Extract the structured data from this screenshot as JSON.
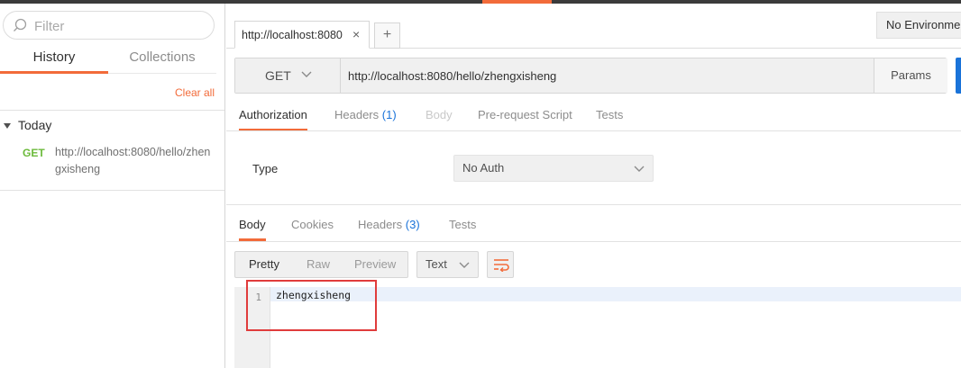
{
  "sidebar": {
    "filter_placeholder": "Filter",
    "tabs": [
      {
        "label": "History",
        "active": true
      },
      {
        "label": "Collections",
        "active": false
      }
    ],
    "clear_all": "Clear all",
    "group_label": "Today",
    "history": [
      {
        "method": "GET",
        "url": "http://localhost:8080/hello/zhengxisheng"
      }
    ]
  },
  "main": {
    "request_tab_label": "http://localhost:8080",
    "add_tab": "+",
    "close_tab": "×",
    "environment": "No Environment",
    "method": "GET",
    "url": "http://localhost:8080/hello/zhengxisheng",
    "params_label": "Params",
    "request_tabs": {
      "authorization": "Authorization",
      "headers": "Headers",
      "headers_count": "(1)",
      "body": "Body",
      "prerequest": "Pre-request Script",
      "tests": "Tests"
    },
    "auth": {
      "type_label": "Type",
      "type_value": "No Auth"
    },
    "response_tabs": {
      "body": "Body",
      "cookies": "Cookies",
      "headers": "Headers",
      "headers_count": "(3)",
      "tests": "Tests"
    },
    "view_modes": [
      "Pretty",
      "Raw",
      "Preview"
    ],
    "format": "Text",
    "editor": {
      "line_number": "1",
      "content": "zhengxisheng"
    }
  },
  "colors": {
    "accent": "#f26b3a",
    "get_method": "#6cba3b",
    "count_blue": "#1a73d9",
    "highlight_red": "#e03c3c"
  }
}
